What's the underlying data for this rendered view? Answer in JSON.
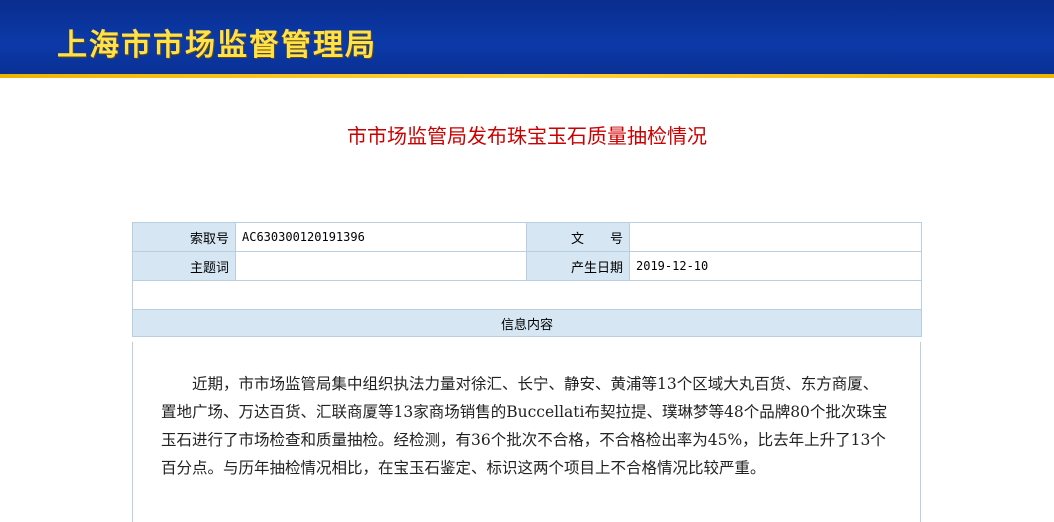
{
  "header": {
    "site_title": "上海市市场监督管理局"
  },
  "article": {
    "title": "市市场监管局发布珠宝玉石质量抽检情况"
  },
  "info_table": {
    "index_label": "索取号",
    "index_value": "AC630300120191396",
    "doc_no_label": "文　　号",
    "doc_no_value": "",
    "subject_label": "主题词",
    "subject_value": "",
    "date_label": "产生日期",
    "date_value": "2019-12-10",
    "content_section_label": "信息内容"
  },
  "content": {
    "paragraph": "近期，市市场监管局集中组织执法力量对徐汇、长宁、静安、黄浦等13个区域大丸百货、东方商厦、置地广场、万达百货、汇联商厦等13家商场销售的Buccellati布契拉提、璞琳梦等48个品牌80个批次珠宝玉石进行了市场检查和质量抽检。经检测，有36个批次不合格，不合格检出率为45%，比去年上升了13个百分点。与历年抽检情况相比，在宝玉石鉴定、标识这两个项目上不合格情况比较严重。"
  }
}
